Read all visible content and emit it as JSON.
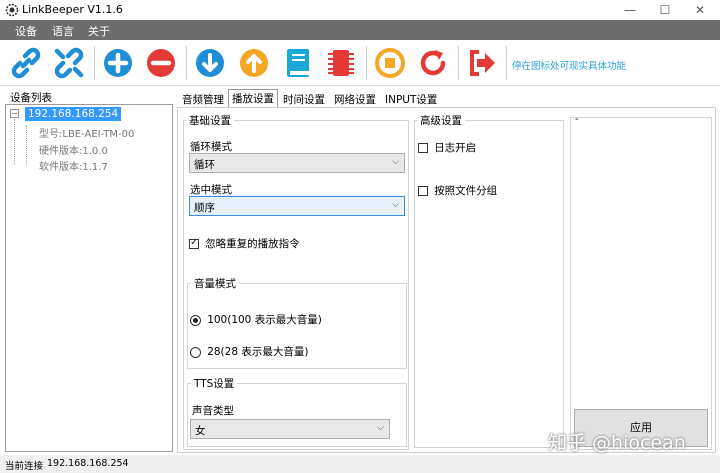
{
  "window": {
    "title": "LinkBeeper V1.1.6",
    "minimize": "—",
    "maximize": "☐",
    "close": "✕"
  },
  "menu": [
    "设备",
    "语言",
    "关于"
  ],
  "toolbar": {
    "icons": [
      "link-icon",
      "unlink-icon",
      "add-icon",
      "remove-icon",
      "download-icon",
      "upload-icon",
      "book-icon",
      "chip-icon",
      "stop-icon",
      "refresh-icon",
      "exit-icon"
    ],
    "hint": "停在图标处可现实具体功能"
  },
  "device_list": {
    "label": "设备列表",
    "root": "192.168.168.254",
    "children": [
      "型号:LBE-AEI-TM-00",
      "硬件版本:1.0.0",
      "软件版本:1.1.7"
    ]
  },
  "tabs": [
    "音频管理",
    "播放设置",
    "时间设置",
    "网络设置",
    "INPUT设置"
  ],
  "active_tab": 1,
  "basic": {
    "title": "基础设置",
    "loop_label": "循环模式",
    "loop_value": "循环",
    "select_label": "选中模式",
    "select_value": "顺序",
    "ignore_repeat": "忽略重复的播放指令",
    "volume": {
      "title": "音量模式",
      "opt1": "100(100 表示最大音量)",
      "opt2": "28(28 表示最大音量)"
    },
    "tts": {
      "title": "TTS设置",
      "voice_label": "声音类型",
      "voice_value": "女"
    }
  },
  "advanced": {
    "title": "高级设置",
    "log": "日志开启",
    "group_by_file": "按照文件分组"
  },
  "right_panel": {
    "dash": "-"
  },
  "apply_label": "应用",
  "status": {
    "label": "当前连接",
    "value": "192.168.168.254"
  },
  "watermark": "知乎 @hiocean",
  "colors": {
    "blue": "#1e8fd6",
    "red": "#e53935",
    "orange": "#f5a623",
    "teal": "#1ca8d6"
  }
}
